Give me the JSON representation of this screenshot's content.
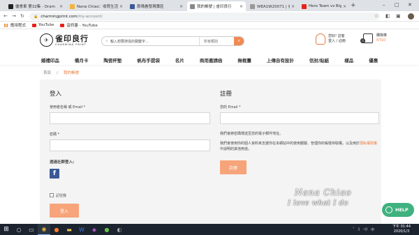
{
  "browser": {
    "tabs": [
      {
        "label": "優食車 第32集 - Dram",
        "favicon": "video-icon",
        "color": "#222222",
        "active": false
      },
      {
        "label": "Nana Chiao：收買生活",
        "favicon": "blog-icon",
        "color": "#f3b33d",
        "active": false
      },
      {
        "label": "那瑪看發現專區",
        "favicon": "facebook-icon",
        "color": "#3b5998",
        "active": false
      },
      {
        "label": "我的帳號 | 雀印良行",
        "favicon": "site-icon",
        "color": "#888888",
        "active": true
      },
      {
        "label": "WEA1W20071 | 雀印",
        "favicon": "site-icon",
        "color": "#999999",
        "active": false
      },
      {
        "label": "Hero Team vs Big Mo",
        "favicon": "youtube-icon",
        "color": "#e62117",
        "active": false
      }
    ],
    "url_domain": "charmingprint.com",
    "url_path": "/my-account/",
    "bookmarks": [
      {
        "label": "應用程式",
        "icon": "apps-grid-icon"
      },
      {
        "label": "YouTube",
        "icon": "youtube-icon"
      },
      {
        "label": "音訊量 - YouTube",
        "icon": "youtube-icon"
      }
    ]
  },
  "site": {
    "logo_cn": "雀印良行",
    "logo_en": "CHARMING PRINT",
    "search_placeholder": "輸入想要搜尋的關鍵字...",
    "search_category": "所有類別",
    "account_greeting": "您好! 訪客",
    "account_action": "登入 / 註冊",
    "cart_label": "購物車",
    "cart_count": "0",
    "cart_total": "NT$0",
    "nav": [
      "婚禮印品",
      "備月卡",
      "陶瓷杯墊",
      "帆布手提袋",
      "名片",
      "商用邀請函",
      "無框畫",
      "上傳自有設計",
      "信封/貼紙",
      "樣品",
      "優惠"
    ],
    "breadcrumb": {
      "home": "首頁",
      "separator": "/",
      "current": "我的帳號"
    },
    "accent_color": "#e87a3d"
  },
  "login": {
    "title": "登入",
    "username_label": "使用者名稱 或 Email *",
    "username_value": "",
    "password_label": "密碼 *",
    "password_value": "",
    "social_label": "透過社群登入:",
    "remember_label": "記住我",
    "button_label": "登入"
  },
  "register": {
    "title": "註冊",
    "email_label": "您的 Email *",
    "email_value": "",
    "password_note": "我們會將密碼傳送至您的電子郵件地址。",
    "privacy_text": "我們會使用你的個人資料來支援你在本網站中的使用體驗、管理你的帳號存取權，以及用於",
    "privacy_link": "隱私權政策",
    "privacy_tail": "中說明的其他用途。",
    "button_label": "註冊"
  },
  "overlay": {
    "watermark_line1": "Nana Chiao",
    "watermark_line2": "I love what I do",
    "help_label": "HELP"
  },
  "taskbar": {
    "time": "下午 01:44",
    "date": "2020/1/3",
    "apps": [
      "search-icon",
      "task-view-icon",
      "chrome-icon",
      "firefox-icon",
      "explorer-icon",
      "word-icon",
      "app-icon",
      "chat-icon",
      "app2-icon"
    ]
  }
}
